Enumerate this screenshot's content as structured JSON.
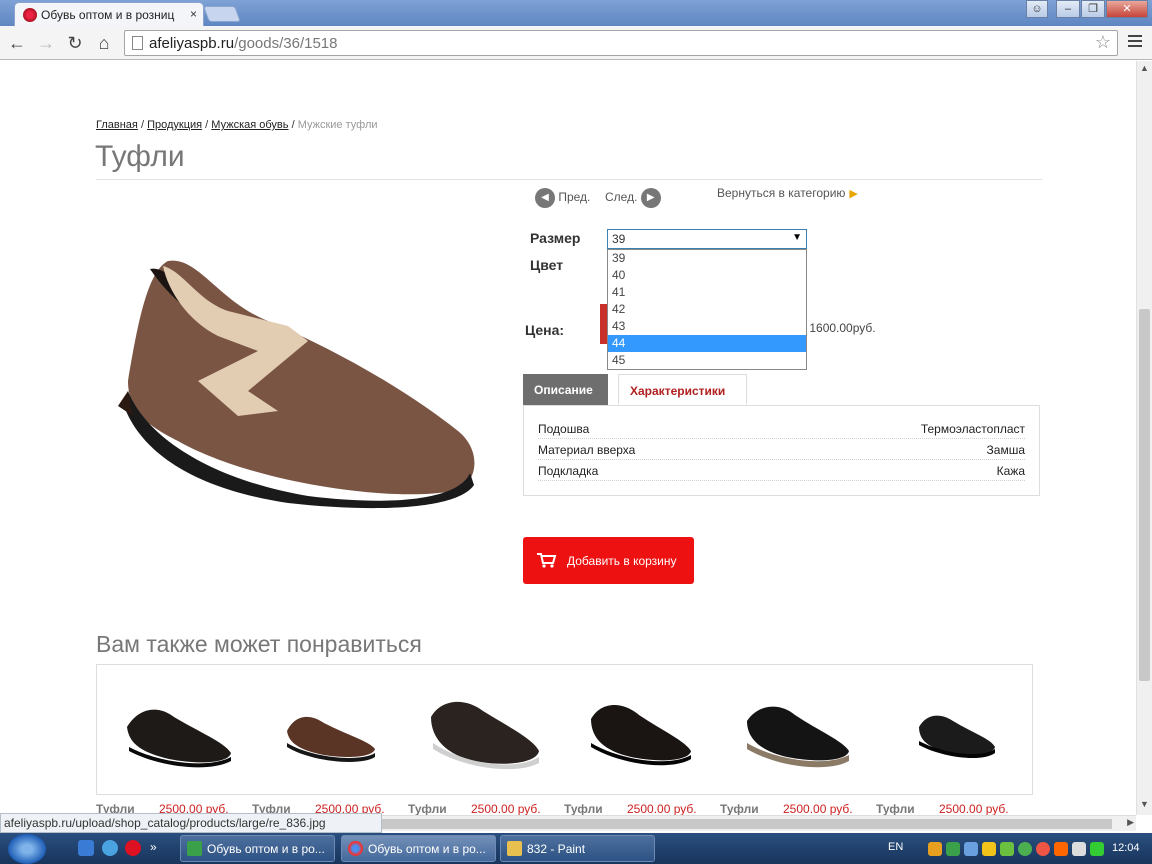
{
  "browser": {
    "tab_title": "Обувь оптом и в розниц",
    "tab_close": "×",
    "url_host": "afeliyaspb.ru",
    "url_path": "/goods/36/1518",
    "status_url": "afeliyaspb.ru/upload/shop_catalog/products/large/re_836.jpg"
  },
  "breadcrumbs": [
    "Главная",
    "Продукция",
    "Мужская обувь",
    "Мужские туфли"
  ],
  "breadcrumb_sep": "/",
  "page_title": "Туфли",
  "nav": {
    "prev": "Пред.",
    "next": "След.",
    "back": "Вернуться в категорию"
  },
  "product": {
    "size_label": "Размер",
    "color_label": "Цвет",
    "price_label": "Цена:",
    "price_text": "р: 1600.00руб.",
    "size_selected": "39",
    "size_options": [
      "39",
      "40",
      "41",
      "42",
      "43",
      "44",
      "45"
    ],
    "size_highlighted": "44"
  },
  "tabs": {
    "description": "Описание",
    "characteristics": "Характеристики"
  },
  "characteristics": [
    {
      "key": "Подошва",
      "value": "Термоэластопласт"
    },
    {
      "key": "Материал вверха",
      "value": "Замша"
    },
    {
      "key": "Подкладка",
      "value": "Кажа"
    }
  ],
  "cart_button": "Добавить в корзину",
  "also_title": "Вам также может понравиться",
  "related": [
    {
      "name": "Туфли",
      "price": "2500.00 руб."
    },
    {
      "name": "Туфли",
      "price": "2500.00 руб."
    },
    {
      "name": "Туфли",
      "price": "2500.00 руб."
    },
    {
      "name": "Туфли",
      "price": "2500.00 руб."
    },
    {
      "name": "Туфли",
      "price": "2500.00 руб."
    },
    {
      "name": "Туфли",
      "price": "2500.00 руб."
    }
  ],
  "taskbar": {
    "items": [
      "Обувь оптом и в ро...",
      "Обувь оптом и в ро...",
      "832 - Paint"
    ],
    "lang": "EN",
    "clock": "12:04"
  },
  "colors": {
    "accent_red": "#ee1111",
    "tab_red": "#b12020",
    "price_red": "#cc2222"
  }
}
